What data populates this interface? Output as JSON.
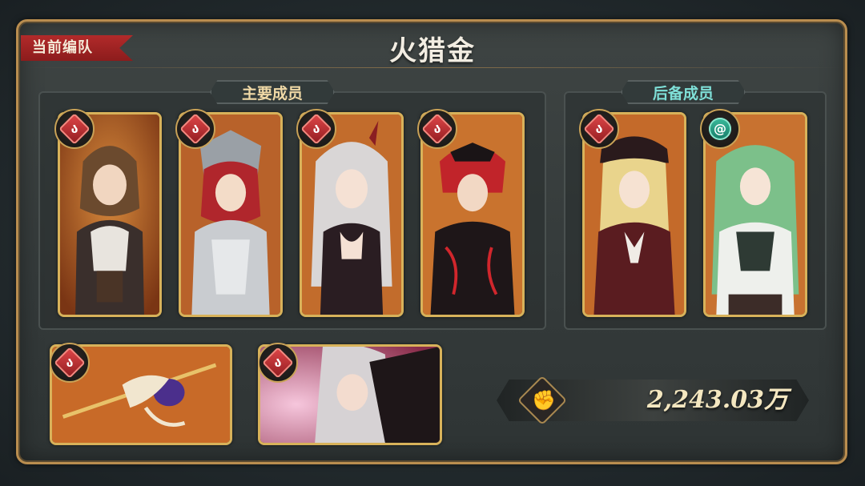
{
  "team_tag": "当前编队",
  "team_name": "火猎金",
  "sections": {
    "main_label": "主要成员",
    "backup_label": "后备成员"
  },
  "colors": {
    "frame_gold": "#b98d4f",
    "fire_element": "#c4363a",
    "wind_element": "#2fae93",
    "power_text": "#f4e7c0"
  },
  "main_members": [
    {
      "element": "fire",
      "icon": "fire-element-icon"
    },
    {
      "element": "fire",
      "icon": "fire-element-icon"
    },
    {
      "element": "fire",
      "icon": "fire-element-icon"
    },
    {
      "element": "fire",
      "icon": "fire-element-icon"
    }
  ],
  "backup_members": [
    {
      "element": "fire",
      "icon": "fire-element-icon"
    },
    {
      "element": "wind",
      "icon": "wind-element-icon"
    }
  ],
  "equipment": [
    {
      "slot": "weapon",
      "element": "fire",
      "icon": "fire-element-icon"
    },
    {
      "slot": "memory",
      "element": "fire",
      "icon": "fire-element-icon"
    }
  ],
  "power": {
    "icon": "fist-icon",
    "value": "2,243.03万"
  }
}
